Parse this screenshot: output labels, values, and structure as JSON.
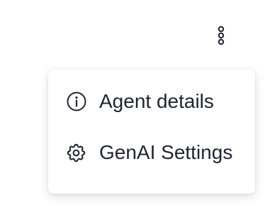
{
  "header": {
    "more_button_icon": "vertical-ellipsis-icon"
  },
  "menu": {
    "items": [
      {
        "label": "Agent details",
        "icon": "info-icon"
      },
      {
        "label": "GenAI Settings",
        "icon": "gear-icon"
      }
    ]
  },
  "colors": {
    "text": "#1e2433",
    "icon": "#1e2433",
    "menu_background": "#ffffff",
    "page_background": "#ffffff"
  }
}
